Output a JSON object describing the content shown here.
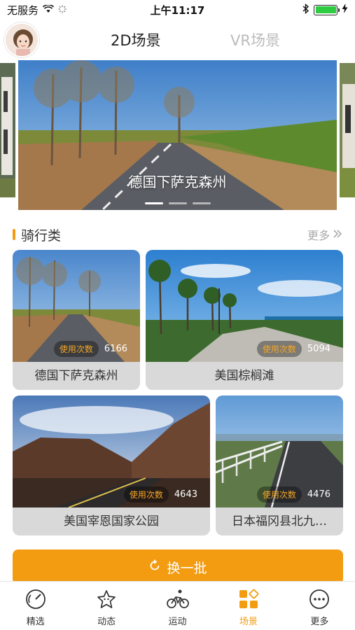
{
  "status_bar": {
    "carrier": "无服务",
    "time": "上午11:17"
  },
  "header": {
    "tabs": [
      {
        "label": "2D场景",
        "active": true
      },
      {
        "label": "VR场景",
        "active": false
      }
    ]
  },
  "banner": {
    "title": "德国下萨克森州",
    "dot_count": 3,
    "active_dot": 0
  },
  "section": {
    "title": "骑行类",
    "more_label": "更多"
  },
  "cards": [
    {
      "title": "德国下萨克森州",
      "usage_label": "使用次数",
      "usage_count": "6166"
    },
    {
      "title": "美国棕榈滩",
      "usage_label": "使用次数",
      "usage_count": "5094"
    },
    {
      "title": "美国宰恩国家公园",
      "usage_label": "使用次数",
      "usage_count": "4643"
    },
    {
      "title": "日本福冈县北九…",
      "usage_label": "使用次数",
      "usage_count": "4476"
    }
  ],
  "refresh_button": {
    "label": "换一批"
  },
  "tabbar": {
    "items": [
      {
        "label": "精选",
        "icon": "gauge-icon"
      },
      {
        "label": "动态",
        "icon": "star-face-icon"
      },
      {
        "label": "运动",
        "icon": "cyclist-icon"
      },
      {
        "label": "场景",
        "icon": "scene-grid-icon",
        "active": true
      },
      {
        "label": "更多",
        "icon": "more-dots-icon"
      }
    ]
  },
  "colors": {
    "accent": "#f39c12",
    "inactive_tab": "#bbbbbb",
    "card_bg": "#d9d9d9"
  }
}
